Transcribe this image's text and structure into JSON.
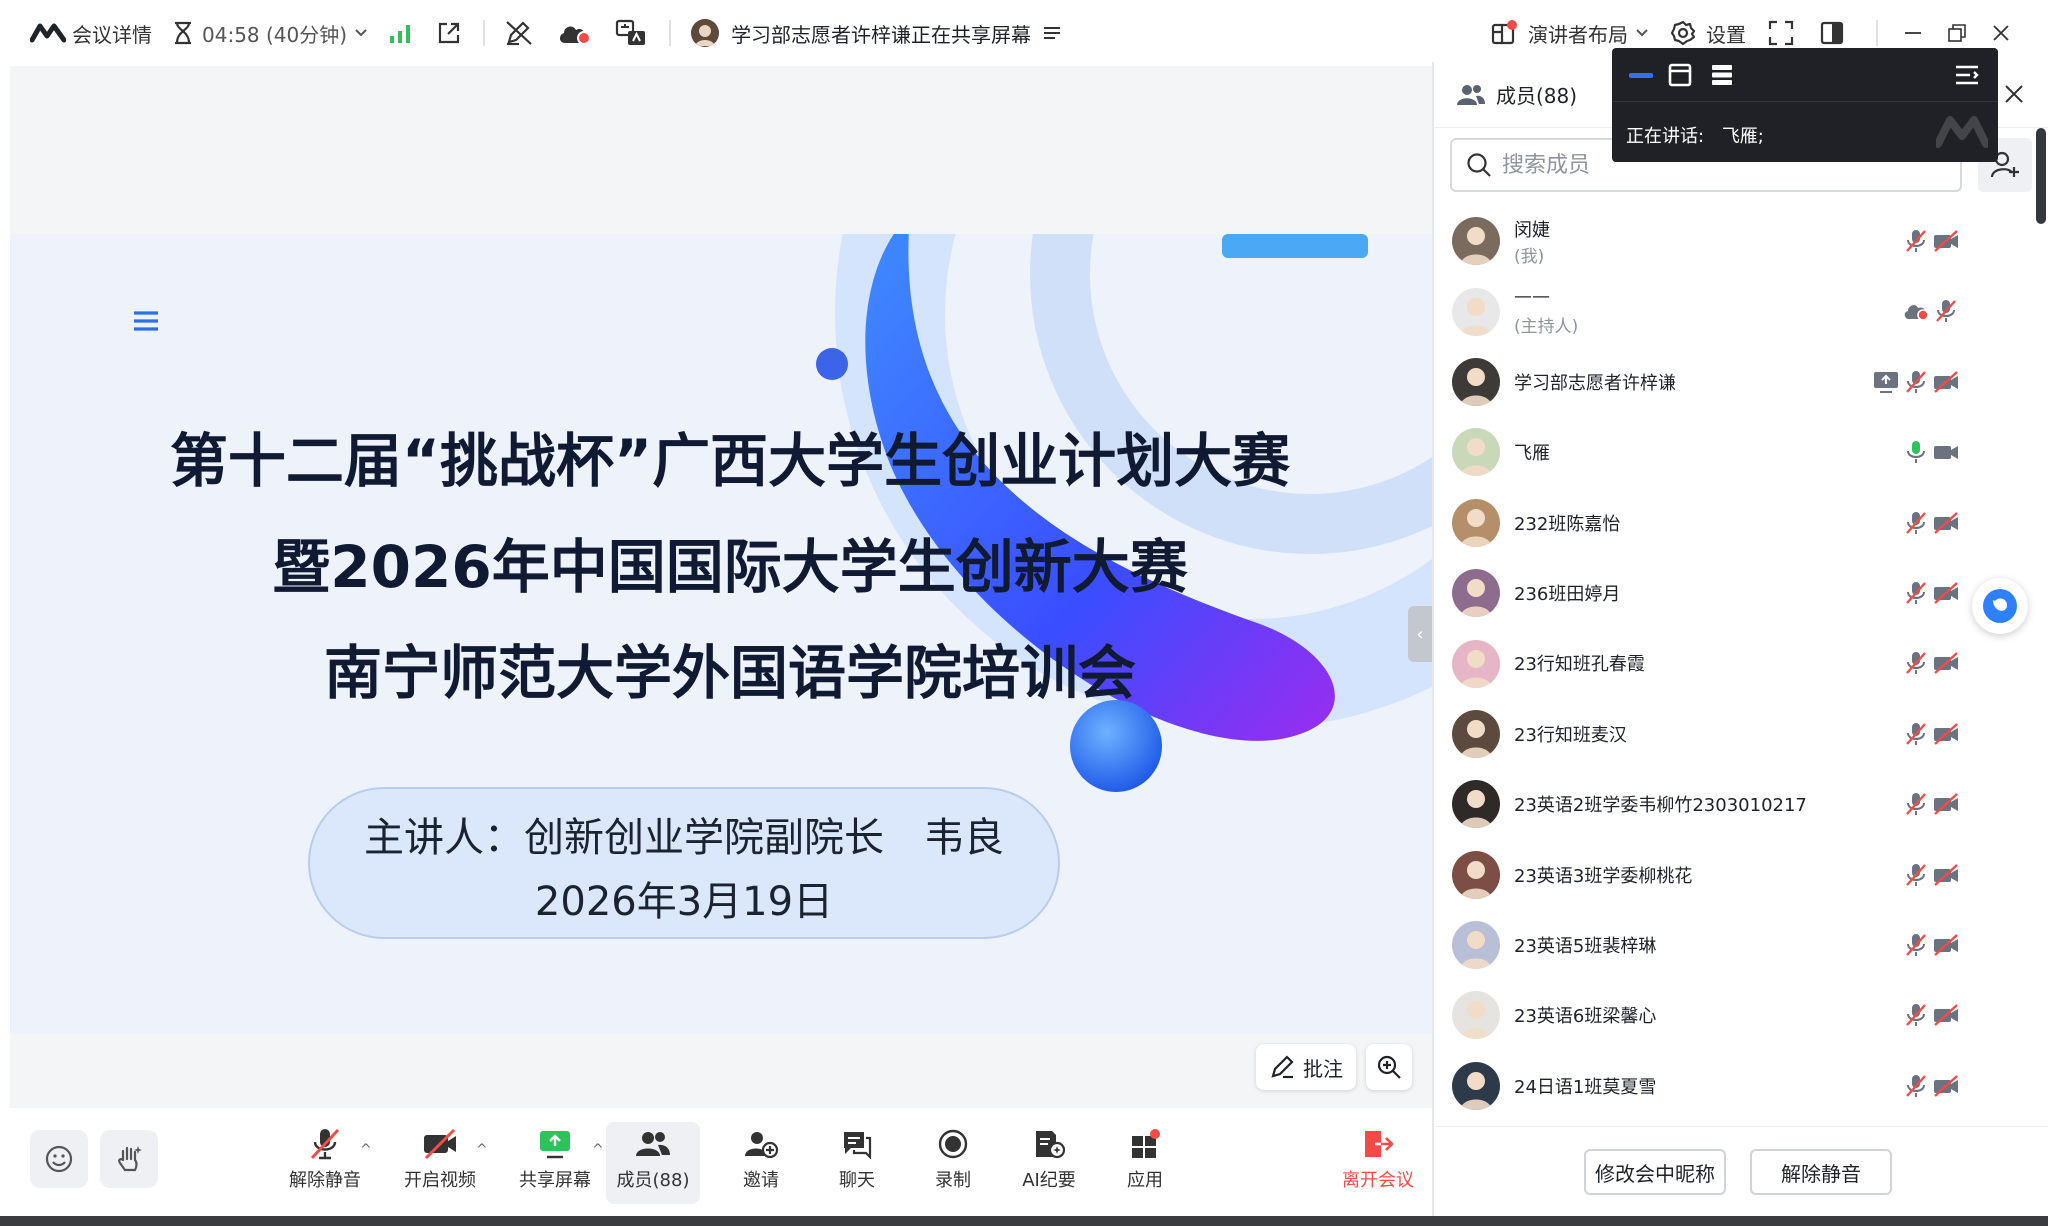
{
  "colors": {
    "accent": "#3370ff",
    "danger": "#f54a45",
    "green": "#2ec25b",
    "leave": "#f54a45",
    "muted_text": "#8f959e"
  },
  "topbar": {
    "meeting_details": "会议详情",
    "timer": "04:58 (40分钟)",
    "sharing_status": "学习部志愿者许梓谦正在共享屏幕",
    "layout_label": "演讲者布局",
    "settings_label": "设置"
  },
  "slide": {
    "title_line1": "第十二届“挑战杯”广西大学生创业计划大赛",
    "title_line2": "暨2026年中国国际大学生创新大赛",
    "title_line3": "南宁师范大学外国语学院培训会",
    "speaker": "主讲人：创新创业学院副院长　韦良",
    "date": "2026年3月19日"
  },
  "stage_tools": {
    "annotate_label": "批注"
  },
  "toolbar": {
    "unmute": "解除静音",
    "start_video": "开启视频",
    "share_screen": "共享屏幕",
    "members": "成员(88)",
    "invite": "邀请",
    "chat": "聊天",
    "record": "录制",
    "ai_minutes": "AI纪要",
    "apps": "应用",
    "leave": "离开会议"
  },
  "panel": {
    "title": "成员(88)",
    "search_placeholder": "搜索成员",
    "members": [
      {
        "name": "闵婕",
        "role": "(我)",
        "icons": [
          "mic-off",
          "video-off"
        ]
      },
      {
        "name": "——",
        "role": "(主持人)",
        "icons": [
          "cloud-record",
          "mic-off"
        ]
      },
      {
        "name": "学习部志愿者许梓谦",
        "role": "",
        "icons": [
          "screen-share",
          "mic-off",
          "video-off"
        ]
      },
      {
        "name": "飞雁",
        "role": "",
        "icons": [
          "mic-on",
          "video-on"
        ]
      },
      {
        "name": "232班陈嘉怡",
        "role": "",
        "icons": [
          "mic-off",
          "video-off"
        ]
      },
      {
        "name": "236班田婷月",
        "role": "",
        "icons": [
          "mic-off",
          "video-off"
        ]
      },
      {
        "name": "23行知班孔春霞",
        "role": "",
        "icons": [
          "mic-off",
          "video-off"
        ]
      },
      {
        "name": "23行知班麦汉",
        "role": "",
        "icons": [
          "mic-off",
          "video-off"
        ]
      },
      {
        "name": "23英语2班学委韦柳竹2303010217",
        "role": "",
        "icons": [
          "mic-off",
          "video-off"
        ]
      },
      {
        "name": "23英语3班学委柳桃花",
        "role": "",
        "icons": [
          "mic-off",
          "video-off"
        ]
      },
      {
        "name": "23英语5班裴梓琳",
        "role": "",
        "icons": [
          "mic-off",
          "video-off"
        ]
      },
      {
        "name": "23英语6班梁馨心",
        "role": "",
        "icons": [
          "mic-off",
          "video-off"
        ]
      },
      {
        "name": "24日语1班莫夏雪",
        "role": "",
        "icons": [
          "mic-off",
          "video-off"
        ]
      }
    ],
    "rename_button": "修改会中昵称",
    "unmute_button": "解除静音"
  },
  "overlay": {
    "speaking_label": "正在讲话:",
    "speaking_name": "飞雁;"
  }
}
